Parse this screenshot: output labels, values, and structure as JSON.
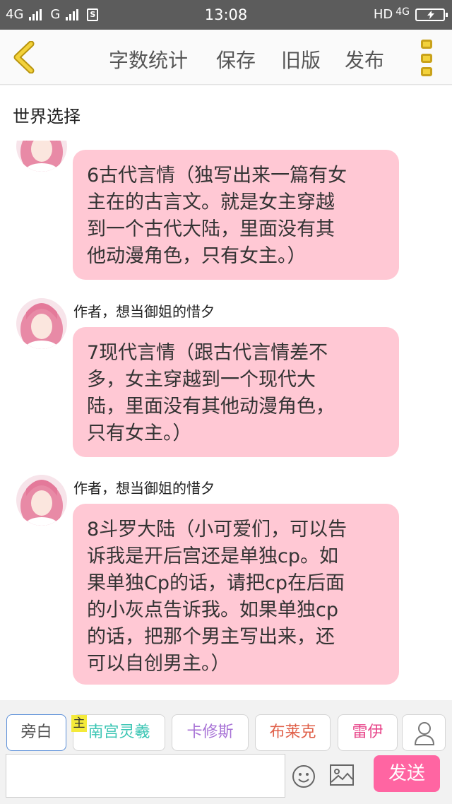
{
  "status_bar": {
    "network1": "4G",
    "network2": "G",
    "time": "13:08",
    "hd": "HD",
    "network3": "4G"
  },
  "nav": {
    "items": [
      "字数统计",
      "保存",
      "旧版",
      "发布"
    ]
  },
  "world": {
    "label": "世界选择"
  },
  "messages": [
    {
      "author": "",
      "text": [
        "6古代言情（独写出来一篇有女",
        "主在的古言文。就是女主穿越",
        "到一个古代大陆，里面没有其",
        "他动漫角色，只有女主。）"
      ]
    },
    {
      "author": "作者，想当御姐的惜夕",
      "text": [
        "7现代言情（跟古代言情差不",
        "多，女主穿越到一个现代大",
        "陆，里面没有其他动漫角色，",
        "只有女主。）"
      ]
    },
    {
      "author": "作者，想当御姐的惜夕",
      "text": [
        "8斗罗大陆（小可爱们，可以告",
        "诉我是开后宫还是单独cp。如",
        "果单独Cp的话，请把cp在后面",
        "的小灰点告诉我。如果单独cp",
        "的话，把那个男主写出来，还",
        "可以自创男主。）"
      ]
    }
  ],
  "roles": [
    {
      "label": "旁白",
      "color": "#555555"
    },
    {
      "label": "南宫灵羲",
      "color": "#3cc6b4"
    },
    {
      "label": "卡修斯",
      "color": "#a873d6"
    },
    {
      "label": "布莱克",
      "color": "#e0614a"
    },
    {
      "label": "雷伊",
      "color": "#e8468a"
    }
  ],
  "main_tag": "主",
  "input": {
    "value": "",
    "placeholder": ""
  },
  "send_label": "发送",
  "colors": {
    "bubble": "#ffc8d4",
    "send": "#ff65a2",
    "accent": "#f3d23b"
  },
  "icons": [
    "back-arrow-icon",
    "more-menu-icon",
    "user-icon",
    "emoji-icon",
    "image-icon"
  ]
}
